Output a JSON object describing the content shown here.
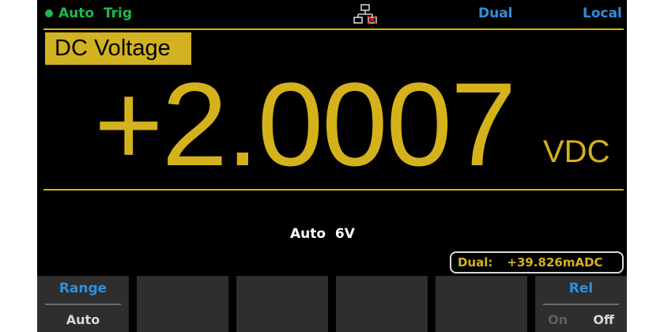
{
  "status_bar": {
    "trigger": "Auto  Trig",
    "mode": "Dual",
    "control": "Local",
    "colors": {
      "trigger": "#1fb94a",
      "flags": "#2f8fd8"
    },
    "lan_icon": "lan-disconnected-icon"
  },
  "measurement": {
    "function": "DC Voltage",
    "reading": "+2.0007",
    "unit": "VDC",
    "range_indicator": "Auto  6V",
    "color": "#d4b21c"
  },
  "dual_display": {
    "label": "Dual:",
    "value": "+39.826mADC"
  },
  "softkeys": [
    {
      "label": "Range",
      "value": "Auto"
    },
    {
      "label": "",
      "value": ""
    },
    {
      "label": "",
      "value": ""
    },
    {
      "label": "",
      "value": ""
    },
    {
      "label": "",
      "value": ""
    },
    {
      "label": "Rel",
      "options": [
        "On",
        "Off"
      ],
      "selected": "Off"
    }
  ]
}
